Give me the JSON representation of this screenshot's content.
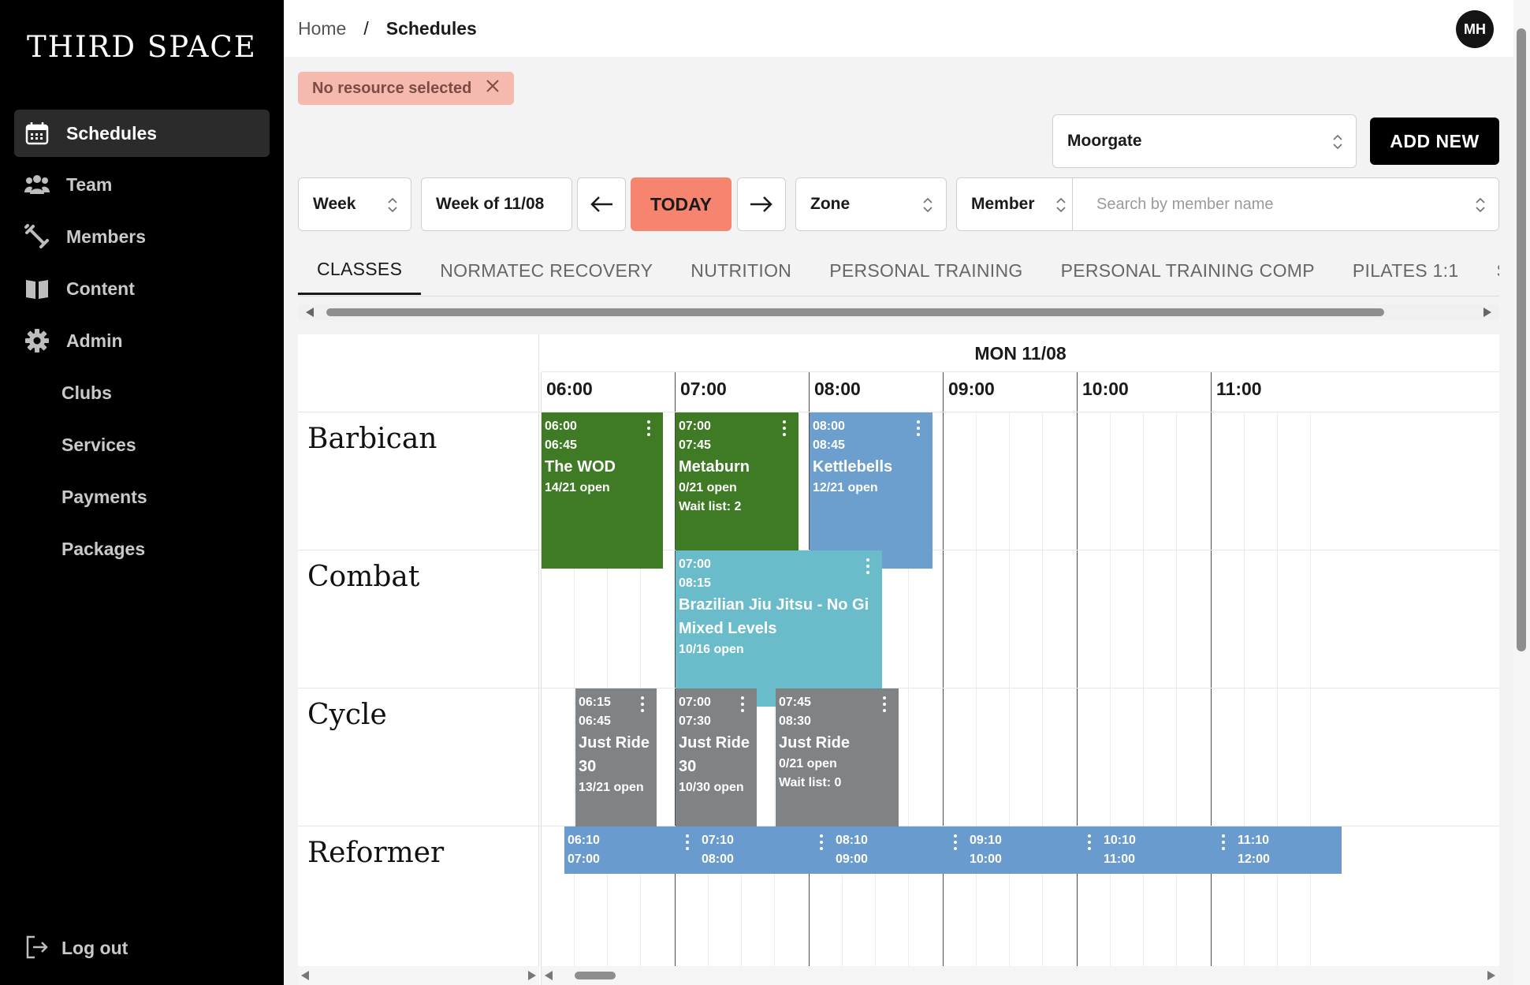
{
  "brand": "THIRD SPACE",
  "sidebar": {
    "items": [
      {
        "label": "Schedules",
        "icon": "calendar-icon"
      },
      {
        "label": "Team",
        "icon": "team-icon"
      },
      {
        "label": "Members",
        "icon": "dumbbell-icon"
      },
      {
        "label": "Content",
        "icon": "book-icon"
      },
      {
        "label": "Admin",
        "icon": "gear-icon"
      },
      {
        "label": "Clubs"
      },
      {
        "label": "Services"
      },
      {
        "label": "Payments"
      },
      {
        "label": "Packages"
      }
    ],
    "logout": "Log out"
  },
  "breadcrumb": {
    "home": "Home",
    "separator": "/",
    "current": "Schedules"
  },
  "user": {
    "initials": "MH"
  },
  "filter_chip": {
    "label": "No resource selected"
  },
  "club_select": {
    "value": "Moorgate"
  },
  "add_new": "ADD NEW",
  "toolbar": {
    "view": "Week",
    "week": "Week of 11/08",
    "today": "TODAY",
    "zone": "Zone",
    "member_type": "Member",
    "member_search_placeholder": "Search by member name"
  },
  "tabs": [
    "CLASSES",
    "NORMATEC RECOVERY",
    "NUTRITION",
    "PERSONAL TRAINING",
    "PERSONAL TRAINING COMP",
    "PILATES 1:1",
    "S"
  ],
  "active_tab": "CLASSES",
  "schedule": {
    "day": "MON 11/08",
    "hours": [
      "06:00",
      "07:00",
      "08:00",
      "09:00",
      "10:00",
      "11:00"
    ],
    "resources": [
      "Barbican",
      "Combat",
      "Cycle",
      "Reformer"
    ],
    "events": {
      "barbican": [
        {
          "start": "06:00",
          "end": "06:45",
          "name": "The WOD",
          "open": "14/21 open"
        },
        {
          "start": "07:00",
          "end": "07:45",
          "name": "Metaburn",
          "open": "0/21 open",
          "wait": "Wait list: 2"
        },
        {
          "start": "08:00",
          "end": "08:45",
          "name": "Kettlebells",
          "open": "12/21 open"
        }
      ],
      "combat": [
        {
          "start": "07:00",
          "end": "08:15",
          "name1": "Brazilian Jiu Jitsu - No Gi",
          "name2": "Mixed Levels",
          "open": "10/16 open"
        }
      ],
      "cycle": [
        {
          "start": "06:15",
          "end": "06:45",
          "name1": "Just Ride",
          "name2": "30",
          "open": "13/21 open"
        },
        {
          "start": "07:00",
          "end": "07:30",
          "name1": "Just Ride",
          "name2": "30",
          "open": "10/30 open"
        },
        {
          "start": "07:45",
          "end": "08:30",
          "name": "Just Ride",
          "open": "0/21 open",
          "wait": "Wait list: 0"
        }
      ],
      "reformer": [
        {
          "start": "06:10",
          "end": "07:00"
        },
        {
          "start": "07:10",
          "end": "08:00"
        },
        {
          "start": "08:10",
          "end": "09:00"
        },
        {
          "start": "09:10",
          "end": "10:00"
        },
        {
          "start": "10:10",
          "end": "11:00"
        },
        {
          "start": "11:10",
          "end": "12:00"
        }
      ]
    }
  },
  "colors": {
    "green": "#3f7a24",
    "blue": "#6c9fcd",
    "teal": "#6bbcca",
    "gray": "#7f8386",
    "reformer": "#6a9bcf",
    "today": "#f7846f",
    "chip": "#f6b9ad"
  }
}
